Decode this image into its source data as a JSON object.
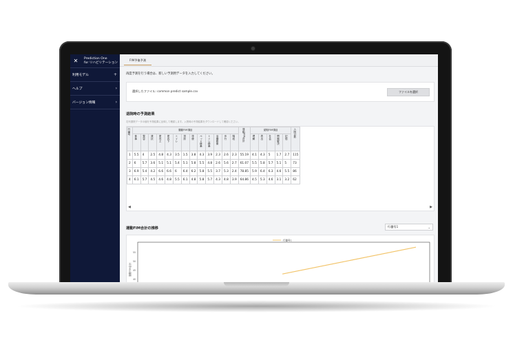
{
  "app": {
    "title_line1": "Prediction One",
    "title_line2": "for リハビリテーション",
    "close_icon": "close-icon"
  },
  "sidebar": {
    "items": [
      {
        "label": "利用モデル",
        "icon": "plus-icon",
        "glyph": "+"
      },
      {
        "label": "ヘルプ",
        "icon": "chevron-right-icon",
        "glyph": "›"
      },
      {
        "label": "バージョン情報",
        "icon": "chevron-right-icon",
        "glyph": "›"
      }
    ]
  },
  "tabs": [
    {
      "label": "FIM予後予測"
    }
  ],
  "instruction": "再度予測を行う場合は、新しい予測用データを入力してください。",
  "upload": {
    "file_label": "選択したファイル: common predict sample.csv",
    "button_label": "ファイルを選択"
  },
  "results": {
    "title": "退院時の予測結果",
    "note": "右列退院データの値を予測結果に反映して確認します。入院時の予測結果をダウンロードして確認ください。",
    "headers": {
      "row_no": "行番号",
      "motor_group": "運動FIM項目",
      "motor_cols": [
        "食事",
        "整容",
        "清拭",
        "更衣上",
        "更衣下",
        "トイレ",
        "排尿",
        "排便",
        "ベッド移乗",
        "トイレ移乗",
        "浴槽移乗",
        "歩行",
        "階段"
      ],
      "motor_total": "運動FIM合計",
      "cog_group": "認知FIM項目",
      "cog_cols": [
        "理解",
        "表出",
        "社会",
        "問題解決",
        "記憶"
      ],
      "admission_days": "入院日数"
    },
    "rows": [
      {
        "no": "1",
        "motor": [
          "5.5",
          "4",
          "2.5",
          "4.8",
          "4.3",
          "3.5",
          "1.5",
          "3.8",
          "4.3",
          "3.9",
          "2.3",
          "2.6",
          "2.3"
        ],
        "motor_total": "55.19",
        "cog": [
          "4.1",
          "4.3",
          "5",
          "1.7",
          "2.7"
        ],
        "days": "115"
      },
      {
        "no": "2",
        "motor": [
          "6",
          "5.7",
          "3.6",
          "5.1",
          "5.1",
          "5.4",
          "5.1",
          "5.8",
          "5.5",
          "4.8",
          "2.6",
          "5.6",
          "2.7"
        ],
        "motor_total": "61.07",
        "cog": [
          "5.5",
          "5.8",
          "5.7",
          "5.1",
          "5"
        ],
        "days": "73"
      },
      {
        "no": "3",
        "motor": [
          "6.9",
          "5.4",
          "4.2",
          "6.6",
          "6.6",
          "6",
          "6.4",
          "6.2",
          "5.8",
          "5.5",
          "3.7",
          "5.3",
          "2.4"
        ],
        "motor_total": "78.85",
        "cog": [
          "5.9",
          "6.4",
          "6.3",
          "4.6",
          "5.5"
        ],
        "days": "86"
      },
      {
        "no": "4",
        "motor": [
          "6.1",
          "5.7",
          "4.5",
          "4.6",
          "4.8",
          "5.5",
          "6.1",
          "4.8",
          "5.8",
          "5.7",
          "4.3",
          "4.8",
          "3.9"
        ],
        "motor_total": "64.86",
        "cog": [
          "4.5",
          "5.3",
          "4.6",
          "3.1",
          "3.2"
        ],
        "days": "62"
      }
    ],
    "scroll_left": "◀",
    "scroll_right": "▶"
  },
  "chart_section": {
    "title": "運動FIM合計の推移",
    "select_value": "行番号1",
    "select_icon": "chevron-down-icon",
    "select_glyph": "⌄"
  },
  "chart_data": {
    "type": "line",
    "series": [
      {
        "name": "行番号1",
        "values": [
          {
            "x": 0.52,
            "y": 43
          },
          {
            "x": 1.0,
            "y": 58
          }
        ]
      }
    ],
    "ylabel": "運動FIM合計",
    "ytick_labels": [
      "55",
      "50",
      "45",
      "40"
    ],
    "grid": false,
    "legend": "top-center"
  },
  "colors": {
    "sidebar_bg": "#0f1838",
    "accent": "#c79a5d",
    "line": "#f2c46a"
  }
}
